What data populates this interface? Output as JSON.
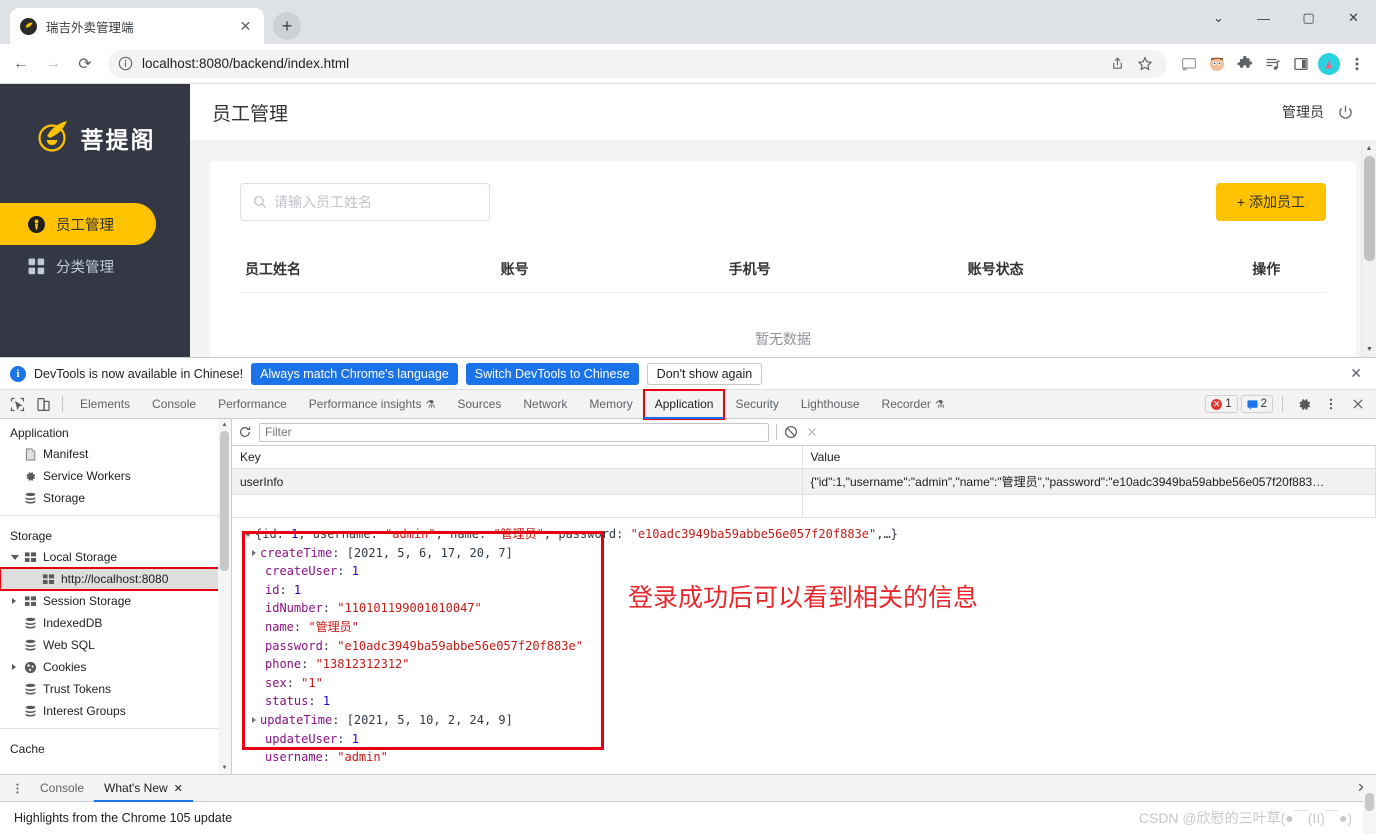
{
  "browser": {
    "tab_title": "瑞吉外卖管理端",
    "tab_close": "✕",
    "new_tab": "+",
    "window_controls": {
      "minimize": "—",
      "maximize": "▢",
      "close": "✕",
      "chevron": "⌄"
    },
    "nav": {
      "back": "←",
      "forward": "→",
      "reload": "⟳"
    },
    "url": "localhost:8080/backend/index.html",
    "site_info_icon": "info-circle-icon",
    "url_right_icons": [
      "share-icon",
      "bookmark-star-icon"
    ],
    "extension_icons": [
      "cast-icon",
      "avatar-extension-icon",
      "puzzle-extension-icon",
      "reading-list-icon",
      "side-panel-icon",
      "profile-icon",
      "kebab-menu-icon"
    ]
  },
  "page": {
    "logo_text": "菩提阁",
    "menu": [
      {
        "label": "员工管理",
        "icon": "employee-icon",
        "active": true
      },
      {
        "label": "分类管理",
        "icon": "category-icon",
        "active": false
      }
    ],
    "title": "员工管理",
    "admin_label": "管理员",
    "power_icon": "power-icon",
    "search_placeholder": "请输入员工姓名",
    "search_value": "",
    "add_button": "+ 添加员工",
    "table": {
      "columns": [
        "员工姓名",
        "账号",
        "手机号",
        "账号状态",
        "操作"
      ],
      "rows": [],
      "empty_text": "暂无数据"
    }
  },
  "devtools": {
    "notice": {
      "text": "DevTools is now available in Chinese!",
      "btn_always": "Always match Chrome's language",
      "btn_switch": "Switch DevTools to Chinese",
      "btn_dismiss": "Don't show again",
      "close": "✕"
    },
    "tabs": [
      {
        "label": "Elements",
        "selected": false
      },
      {
        "label": "Console",
        "selected": false
      },
      {
        "label": "Performance",
        "selected": false
      },
      {
        "label": "Performance insights",
        "selected": false,
        "beaker": "⚗"
      },
      {
        "label": "Sources",
        "selected": false
      },
      {
        "label": "Network",
        "selected": false
      },
      {
        "label": "Memory",
        "selected": false
      },
      {
        "label": "Application",
        "selected": true,
        "highlighted": true
      },
      {
        "label": "Security",
        "selected": false
      },
      {
        "label": "Lighthouse",
        "selected": false
      },
      {
        "label": "Recorder",
        "selected": false,
        "beaker": "⚗"
      }
    ],
    "error_count": "1",
    "warning_count": "2",
    "settings_icon": "gear-icon",
    "more_icon": "kebab-menu-icon",
    "close_icon": "close-icon",
    "inspect_icon": "inspect-element-icon",
    "device_icon": "device-toolbar-icon",
    "sidebar": {
      "section_application": "Application",
      "application_items": [
        {
          "label": "Manifest",
          "icon": "manifest-file-icon"
        },
        {
          "label": "Service Workers",
          "icon": "gear-icon"
        },
        {
          "label": "Storage",
          "icon": "database-icon"
        }
      ],
      "section_storage": "Storage",
      "storage_items": [
        {
          "label": "Local Storage",
          "icon": "table-icon",
          "expandable": true,
          "expanded": true,
          "indent": 1
        },
        {
          "label": "http://localhost:8080",
          "icon": "table-icon",
          "expandable": false,
          "indent": 2,
          "selected": true,
          "highlighted": true
        },
        {
          "label": "Session Storage",
          "icon": "table-icon",
          "expandable": true,
          "expanded": false,
          "indent": 1
        },
        {
          "label": "IndexedDB",
          "icon": "database-icon",
          "expandable": false,
          "indent": 1
        },
        {
          "label": "Web SQL",
          "icon": "database-icon",
          "expandable": false,
          "indent": 1
        },
        {
          "label": "Cookies",
          "icon": "cookie-icon",
          "expandable": true,
          "expanded": false,
          "indent": 1
        },
        {
          "label": "Trust Tokens",
          "icon": "database-icon",
          "expandable": false,
          "indent": 1
        },
        {
          "label": "Interest Groups",
          "icon": "database-icon",
          "expandable": false,
          "indent": 1
        }
      ],
      "section_cache": "Cache"
    },
    "filterbar": {
      "refresh_icon": "refresh-icon",
      "placeholder": "Filter",
      "value": "",
      "clear_all_icon": "clear-all-icon",
      "delete_icon": "delete-selected-icon"
    },
    "kv_table": {
      "col_key": "Key",
      "col_value": "Value",
      "rows": [
        {
          "key": "userInfo",
          "value": "{\"id\":1,\"username\":\"admin\",\"name\":\"管理员\",\"password\":\"e10adc3949ba59abbe56e057f20f883…",
          "selected": true
        }
      ]
    },
    "json_preview": {
      "summary_prefix": "{id: ",
      "summary": [
        {
          "t": "plain",
          "v": "{id: "
        },
        {
          "t": "num",
          "v": "1"
        },
        {
          "t": "plain",
          "v": ", username: "
        },
        {
          "t": "str",
          "v": "\"admin\""
        },
        {
          "t": "plain",
          "v": ", name: "
        },
        {
          "t": "str",
          "v": "\"管理员\""
        },
        {
          "t": "plain",
          "v": ", password: "
        },
        {
          "t": "str",
          "v": "\"e10adc3949ba59abbe56e057f20f883e\""
        },
        {
          "t": "plain",
          "v": ",…}"
        }
      ],
      "properties": [
        {
          "key": "createTime",
          "value": "[2021, 5, 6, 17, 20, 7]",
          "type": "plain",
          "expandable": true
        },
        {
          "key": "createUser",
          "value": "1",
          "type": "num",
          "expandable": false
        },
        {
          "key": "id",
          "value": "1",
          "type": "num",
          "expandable": false
        },
        {
          "key": "idNumber",
          "value": "\"110101199001010047\"",
          "type": "str",
          "expandable": false
        },
        {
          "key": "name",
          "value": "\"管理员\"",
          "type": "str",
          "expandable": false
        },
        {
          "key": "password",
          "value": "\"e10adc3949ba59abbe56e057f20f883e\"",
          "type": "str",
          "expandable": false
        },
        {
          "key": "phone",
          "value": "\"13812312312\"",
          "type": "str",
          "expandable": false
        },
        {
          "key": "sex",
          "value": "\"1\"",
          "type": "str",
          "expandable": false
        },
        {
          "key": "status",
          "value": "1",
          "type": "num",
          "expandable": false
        },
        {
          "key": "updateTime",
          "value": "[2021, 5, 10, 2, 24, 9]",
          "type": "plain",
          "expandable": true
        },
        {
          "key": "updateUser",
          "value": "1",
          "type": "num",
          "expandable": false
        },
        {
          "key": "username",
          "value": "\"admin\"",
          "type": "str",
          "expandable": false
        }
      ]
    },
    "annotation": "登录成功后可以看到相关的信息",
    "annotation_color": "#e8282d",
    "drawer": {
      "more_icon": "kebab-menu-icon",
      "tabs": [
        {
          "label": "Console",
          "selected": false
        },
        {
          "label": "What's New",
          "selected": true,
          "close": "✕"
        }
      ],
      "content": "Highlights from the Chrome 105 update",
      "close": "✕"
    }
  },
  "watermark": "CSDN @欣慰的三叶草(●￣(ΙΙ)￣●)",
  "colors": {
    "accent_yellow": "#ffc200",
    "sidebar_dark": "#343744",
    "devtools_blue": "#1a73e8",
    "annotation_red": "#e8282d",
    "highlight_red": "#e60012"
  }
}
